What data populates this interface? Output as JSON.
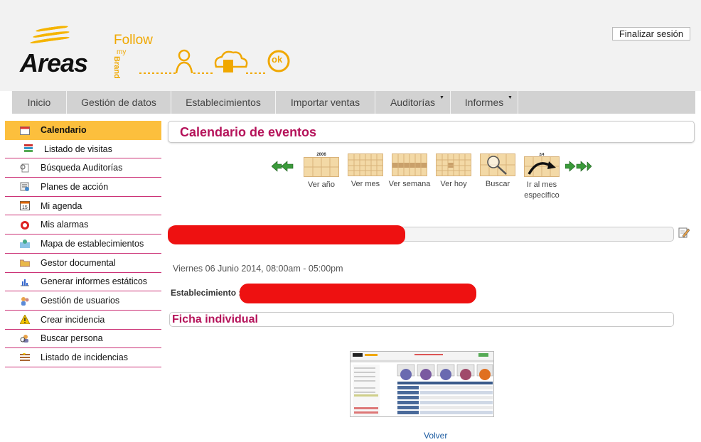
{
  "header": {
    "brand_name": "Areas",
    "follow_logo": {
      "follow": "Follow",
      "my": "my",
      "brand": "Brand",
      "ok": "ok"
    },
    "logout_label": "Finalizar sesión"
  },
  "nav": {
    "items": [
      {
        "label": "Inicio",
        "dropdown": false
      },
      {
        "label": "Gestión de datos",
        "dropdown": false
      },
      {
        "label": "Establecimientos",
        "dropdown": false
      },
      {
        "label": "Importar ventas",
        "dropdown": false
      },
      {
        "label": "Auditorías",
        "dropdown": true
      },
      {
        "label": "Informes",
        "dropdown": true
      }
    ]
  },
  "sidebar": {
    "items": [
      {
        "label": "Calendario",
        "icon": "calendar-icon",
        "active": true
      },
      {
        "label": "Listado de visitas",
        "icon": "books-icon",
        "sub": true
      },
      {
        "label": "Búsqueda Auditorías",
        "icon": "search-doc-icon"
      },
      {
        "label": "Planes de acción",
        "icon": "plan-icon"
      },
      {
        "label": "Mi agenda",
        "icon": "agenda-icon"
      },
      {
        "label": "Mis alarmas",
        "icon": "alarm-icon"
      },
      {
        "label": "Mapa de establecimientos",
        "icon": "map-icon"
      },
      {
        "label": "Gestor documental",
        "icon": "folder-icon"
      },
      {
        "label": "Generar informes estáticos",
        "icon": "report-chart-icon"
      },
      {
        "label": "Gestión de usuarios",
        "icon": "users-icon"
      },
      {
        "label": "Crear incidencia",
        "icon": "warning-icon"
      },
      {
        "label": "Buscar persona",
        "icon": "person-search-icon"
      },
      {
        "label": "Listado de incidencias",
        "icon": "incident-list-icon"
      }
    ]
  },
  "main": {
    "title": "Calendario de eventos",
    "calendar_nav": {
      "year_caption": "2006",
      "month_caption": "2/4",
      "buttons": [
        {
          "label": "Ver año"
        },
        {
          "label": "Ver mes"
        },
        {
          "label": "Ver semana"
        },
        {
          "label": "Ver hoy"
        },
        {
          "label": "Buscar"
        },
        {
          "label": "Ir al mes",
          "label2": "específico"
        }
      ]
    },
    "date_text": "Viernes 06 Junio 2014, 08:00am - 05:00pm",
    "establecimiento_label": "Establecimiento :",
    "ficha_title": "Ficha individual",
    "volver_label": "Volver"
  },
  "colors": {
    "accent_magenta": "#b5135a",
    "active_yellow": "#fcbf3d",
    "brand_yellow": "#f0a800",
    "redaction_red": "#ee1111",
    "nav_gray": "#d2d2d2"
  }
}
